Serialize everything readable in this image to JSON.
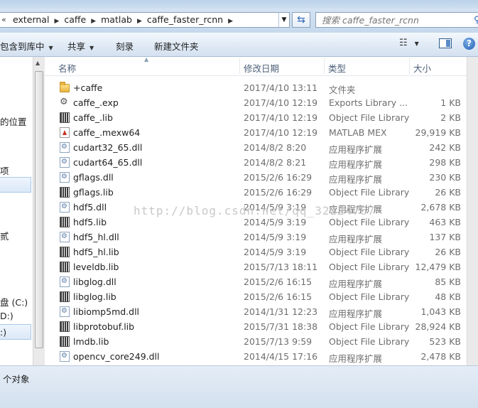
{
  "address": {
    "overflow": "«",
    "crumbs": [
      "external",
      "caffe",
      "matlab",
      "caffe_faster_rcnn"
    ]
  },
  "search": {
    "placeholder": "搜索 caffe_faster_rcnn"
  },
  "toolbar": {
    "include_in_library": "包含到库中",
    "share": "共享",
    "burn": "刻录",
    "new_folder": "新建文件夹"
  },
  "nav": {
    "items": [
      "的位置",
      "项",
      "贰",
      "盘 (C:)",
      "D:)",
      ":)"
    ]
  },
  "columns": {
    "name": "名称",
    "date": "修改日期",
    "type": "类型",
    "size": "大小"
  },
  "files": [
    {
      "name": "+caffe",
      "date": "2017/4/10 13:11",
      "type": "文件夹",
      "size": "",
      "icon": "folder-icon"
    },
    {
      "name": "caffe_.exp",
      "date": "2017/4/10 12:19",
      "type": "Exports Library ...",
      "size": "1 KB",
      "icon": "exp-file-icon"
    },
    {
      "name": "caffe_.lib",
      "date": "2017/4/10 12:19",
      "type": "Object File Library",
      "size": "2 KB",
      "icon": "lib-file-icon"
    },
    {
      "name": "caffe_.mexw64",
      "date": "2017/4/10 12:19",
      "type": "MATLAB MEX",
      "size": "29,919 KB",
      "icon": "mex-file-icon"
    },
    {
      "name": "cudart32_65.dll",
      "date": "2014/8/2 8:20",
      "type": "应用程序扩展",
      "size": "242 KB",
      "icon": "dll-file-icon"
    },
    {
      "name": "cudart64_65.dll",
      "date": "2014/8/2 8:21",
      "type": "应用程序扩展",
      "size": "298 KB",
      "icon": "dll-file-icon"
    },
    {
      "name": "gflags.dll",
      "date": "2015/2/6 16:29",
      "type": "应用程序扩展",
      "size": "230 KB",
      "icon": "dll-file-icon"
    },
    {
      "name": "gflags.lib",
      "date": "2015/2/6 16:29",
      "type": "Object File Library",
      "size": "26 KB",
      "icon": "lib-file-icon"
    },
    {
      "name": "hdf5.dll",
      "date": "2014/5/9 3:19",
      "type": "应用程序扩展",
      "size": "2,678 KB",
      "icon": "dll-file-icon"
    },
    {
      "name": "hdf5.lib",
      "date": "2014/5/9 3:19",
      "type": "Object File Library",
      "size": "463 KB",
      "icon": "lib-file-icon"
    },
    {
      "name": "hdf5_hl.dll",
      "date": "2014/5/9 3:19",
      "type": "应用程序扩展",
      "size": "137 KB",
      "icon": "dll-file-icon"
    },
    {
      "name": "hdf5_hl.lib",
      "date": "2014/5/9 3:19",
      "type": "Object File Library",
      "size": "26 KB",
      "icon": "lib-file-icon"
    },
    {
      "name": "leveldb.lib",
      "date": "2015/7/13 18:11",
      "type": "Object File Library",
      "size": "12,479 KB",
      "icon": "lib-file-icon"
    },
    {
      "name": "libglog.dll",
      "date": "2015/2/6 16:15",
      "type": "应用程序扩展",
      "size": "85 KB",
      "icon": "dll-file-icon"
    },
    {
      "name": "libglog.lib",
      "date": "2015/2/6 16:15",
      "type": "Object File Library",
      "size": "48 KB",
      "icon": "lib-file-icon"
    },
    {
      "name": "libiomp5md.dll",
      "date": "2014/1/31 12:23",
      "type": "应用程序扩展",
      "size": "1,043 KB",
      "icon": "dll-file-icon"
    },
    {
      "name": "libprotobuf.lib",
      "date": "2015/7/31 18:38",
      "type": "Object File Library",
      "size": "28,924 KB",
      "icon": "lib-file-icon"
    },
    {
      "name": "lmdb.lib",
      "date": "2015/7/13 9:59",
      "type": "Object File Library",
      "size": "523 KB",
      "icon": "lib-file-icon"
    },
    {
      "name": "opencv_core249.dll",
      "date": "2014/4/15 17:16",
      "type": "应用程序扩展",
      "size": "2,478 KB",
      "icon": "dll-file-icon"
    }
  ],
  "watermark": "http://blog.csdn.net/qq_32224767",
  "status": {
    "text": "个对象"
  },
  "colors": {
    "toolbar_bg": "#dde7f3",
    "accent": "#2c67b8"
  }
}
